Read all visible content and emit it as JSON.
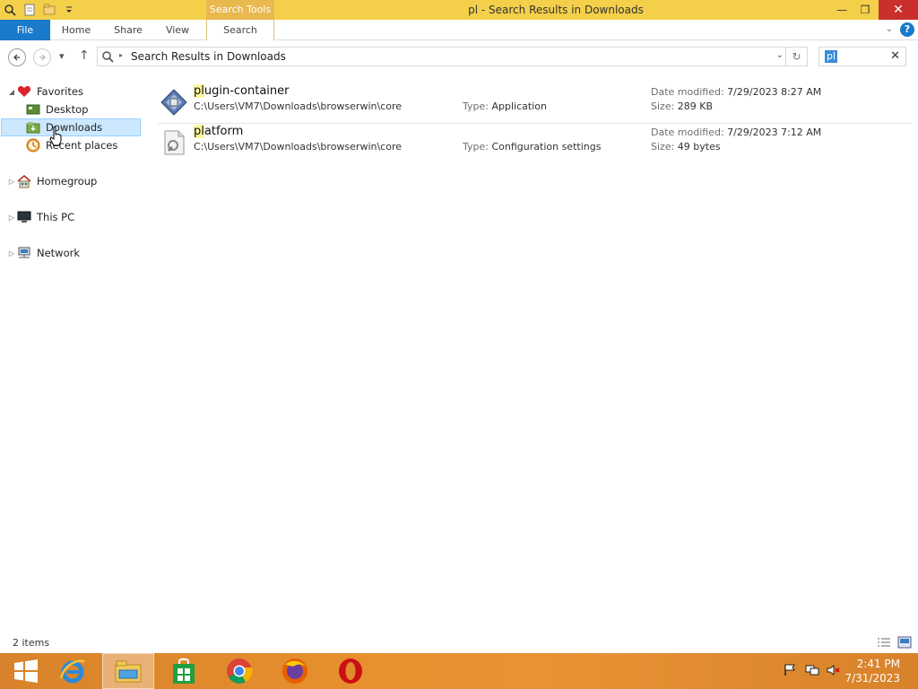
{
  "window": {
    "title": "pl - Search Results in Downloads",
    "context_tab": "Search Tools",
    "minimize_glyph": "—",
    "restore_glyph": "❐",
    "close_glyph": "✕"
  },
  "ribbon": {
    "tabs": [
      "File",
      "Home",
      "Share",
      "View",
      "Search"
    ]
  },
  "address": {
    "breadcrumb": "Search Results in Downloads",
    "search_value": "pl"
  },
  "nav": {
    "favorites": "Favorites",
    "desktop": "Desktop",
    "downloads": "Downloads",
    "recent": "Recent places",
    "homegroup": "Homegroup",
    "thispc": "This PC",
    "network": "Network"
  },
  "results": [
    {
      "name_hl": "pl",
      "name_rest": "ugin-container",
      "path": "C:\\Users\\VM7\\Downloads\\browserwin\\core",
      "type_label": "Type:",
      "type": "Application",
      "date_label": "Date modified:",
      "date": "7/29/2023 8:27 AM",
      "size_label": "Size:",
      "size": "289 KB",
      "icon": "application-icon"
    },
    {
      "name_hl": "pl",
      "name_rest": "atform",
      "path": "C:\\Users\\VM7\\Downloads\\browserwin\\core",
      "type_label": "Type:",
      "type": "Configuration settings",
      "date_label": "Date modified:",
      "date": "7/29/2023 7:12 AM",
      "size_label": "Size:",
      "size": "49 bytes",
      "icon": "settings-file-icon"
    }
  ],
  "status": {
    "item_count": "2 items"
  },
  "taskbar": {
    "time": "2:41 PM",
    "date": "7/31/2023"
  },
  "colors": {
    "title_bar": "#f4d04a",
    "file_tab": "#1979ca",
    "taskbar": "#e08a2e",
    "selection": "#cce8ff"
  }
}
